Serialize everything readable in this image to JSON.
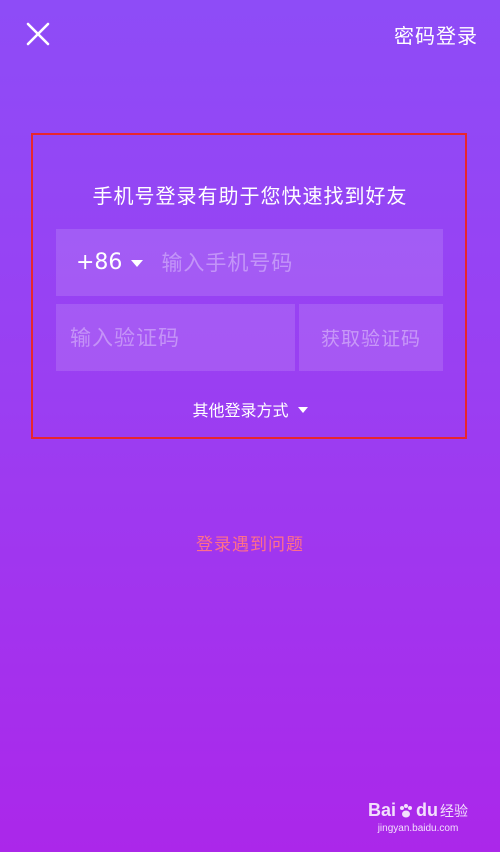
{
  "header": {
    "close_icon": "close-icon",
    "password_login_label": "密码登录"
  },
  "login": {
    "headline": "手机号登录有助于您快速找到好友",
    "country_code": "+86",
    "phone_placeholder": "输入手机号码",
    "code_placeholder": "输入验证码",
    "get_code_label": "获取验证码",
    "other_methods_label": "其他登录方式"
  },
  "help": {
    "problem_label": "登录遇到问题"
  },
  "watermark": {
    "brand_a": "Bai",
    "brand_b": "du",
    "suffix": "经验",
    "url": "jingyan.baidu.com"
  },
  "colors": {
    "bg_top": "#8e4cf7",
    "bg_bottom": "#ab27ea",
    "highlight_border": "#e8262d",
    "problem_link": "#ff6f8a"
  }
}
